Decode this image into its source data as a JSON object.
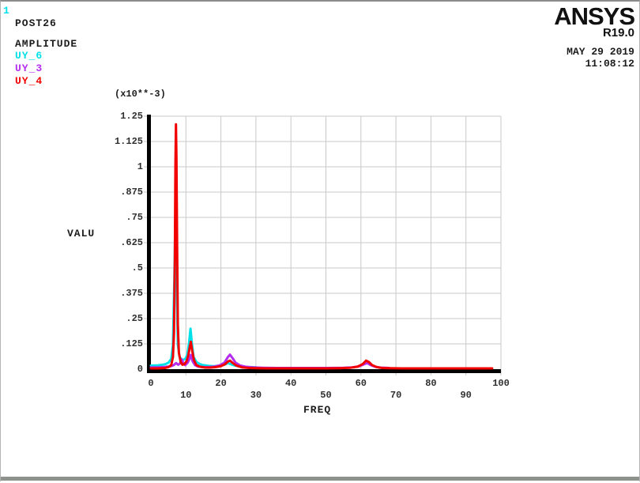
{
  "header": {
    "frame_number": "1",
    "routine": "POST26",
    "plot_type": "AMPLITUDE",
    "legend": [
      {
        "label": "UY_6",
        "color": "#00E0E8"
      },
      {
        "label": "UY_3",
        "color": "#B32CEF"
      },
      {
        "label": "UY_4",
        "color": "#F20000"
      }
    ]
  },
  "brand": {
    "name": "ANSYS",
    "release": "R19.0",
    "date": "MAY 29 2019",
    "time": "11:08:12"
  },
  "chart_data": {
    "type": "line",
    "title": "AMPLITUDE",
    "xlabel": "FREQ",
    "ylabel": "VALU",
    "y_scale_label": "(x10**-3)",
    "xlim": [
      0,
      100
    ],
    "ylim": [
      0,
      1.25
    ],
    "grid": true,
    "grid_color": "#c9c9c9",
    "axis_color": "#000000",
    "x_ticks": [
      {
        "value": 0,
        "label": "0"
      },
      {
        "value": 10,
        "label": "10"
      },
      {
        "value": 20,
        "label": "20"
      },
      {
        "value": 30,
        "label": "30"
      },
      {
        "value": 40,
        "label": "40"
      },
      {
        "value": 50,
        "label": "50"
      },
      {
        "value": 60,
        "label": "60"
      },
      {
        "value": 70,
        "label": "70"
      },
      {
        "value": 80,
        "label": "80"
      },
      {
        "value": 90,
        "label": "90"
      },
      {
        "value": 100,
        "label": "100"
      }
    ],
    "y_ticks": [
      {
        "value": 0,
        "label": "0"
      },
      {
        "value": 0.125,
        "label": ".125"
      },
      {
        "value": 0.25,
        "label": ".25"
      },
      {
        "value": 0.375,
        "label": ".375"
      },
      {
        "value": 0.5,
        "label": ".5"
      },
      {
        "value": 0.625,
        "label": ".625"
      },
      {
        "value": 0.75,
        "label": ".75"
      },
      {
        "value": 0.875,
        "label": ".875"
      },
      {
        "value": 1,
        "label": "1"
      },
      {
        "value": 1.125,
        "label": "1.125"
      },
      {
        "value": 1.25,
        "label": "1.25"
      }
    ],
    "series": [
      {
        "name": "UY_6",
        "color": "#00E0E8",
        "points": [
          [
            0,
            0.018
          ],
          [
            1,
            0.018
          ],
          [
            2,
            0.019
          ],
          [
            3,
            0.021
          ],
          [
            4,
            0.024
          ],
          [
            5,
            0.032
          ],
          [
            5.8,
            0.05
          ],
          [
            6.3,
            0.12
          ],
          [
            6.7,
            0.45
          ],
          [
            7.0,
            0.77
          ],
          [
            7.3,
            0.45
          ],
          [
            7.7,
            0.12
          ],
          [
            8.2,
            0.06
          ],
          [
            9,
            0.045
          ],
          [
            9.8,
            0.05
          ],
          [
            10.4,
            0.07
          ],
          [
            10.9,
            0.13
          ],
          [
            11.3,
            0.2
          ],
          [
            11.7,
            0.13
          ],
          [
            12.2,
            0.06
          ],
          [
            13,
            0.035
          ],
          [
            14,
            0.025
          ],
          [
            15,
            0.02
          ],
          [
            16.5,
            0.016
          ],
          [
            18,
            0.015
          ],
          [
            19.5,
            0.017
          ],
          [
            21,
            0.022
          ],
          [
            22,
            0.03
          ],
          [
            22.6,
            0.026
          ],
          [
            24,
            0.018
          ],
          [
            25.5,
            0.013
          ],
          [
            27,
            0.011
          ],
          [
            28.5,
            0.01
          ],
          [
            30,
            0.009
          ]
        ]
      },
      {
        "name": "UY_3",
        "color": "#B32CEF",
        "points": [
          [
            0,
            0.009
          ],
          [
            2,
            0.009
          ],
          [
            4,
            0.011
          ],
          [
            5.5,
            0.014
          ],
          [
            6.5,
            0.02
          ],
          [
            7.2,
            0.03
          ],
          [
            7.8,
            0.022
          ],
          [
            8.3,
            0.028
          ],
          [
            8.8,
            0.048
          ],
          [
            9.3,
            0.028
          ],
          [
            9.8,
            0.02
          ],
          [
            10.5,
            0.032
          ],
          [
            11,
            0.05
          ],
          [
            11.4,
            0.07
          ],
          [
            11.9,
            0.04
          ],
          [
            12.6,
            0.02
          ],
          [
            13.5,
            0.013
          ],
          [
            15,
            0.01
          ],
          [
            16.5,
            0.01
          ],
          [
            18,
            0.012
          ],
          [
            19.5,
            0.018
          ],
          [
            21,
            0.032
          ],
          [
            22,
            0.06
          ],
          [
            22.6,
            0.072
          ],
          [
            23.3,
            0.055
          ],
          [
            24.2,
            0.032
          ],
          [
            25.5,
            0.018
          ],
          [
            27,
            0.012
          ],
          [
            29,
            0.009
          ],
          [
            32,
            0.007
          ],
          [
            36,
            0.006
          ],
          [
            40,
            0.006
          ],
          [
            45,
            0.006
          ],
          [
            50,
            0.006
          ],
          [
            55,
            0.007
          ],
          [
            57.5,
            0.009
          ],
          [
            59.5,
            0.014
          ],
          [
            61,
            0.025
          ],
          [
            61.8,
            0.03
          ],
          [
            62.8,
            0.02
          ],
          [
            64,
            0.012
          ],
          [
            65.5,
            0.008
          ],
          [
            67,
            0.007
          ],
          [
            68,
            0.006
          ]
        ]
      },
      {
        "name": "UY_4",
        "color": "#F20000",
        "points": [
          [
            0,
            0.004
          ],
          [
            2,
            0.004
          ],
          [
            4,
            0.006
          ],
          [
            5,
            0.01
          ],
          [
            5.8,
            0.02
          ],
          [
            6.3,
            0.06
          ],
          [
            6.6,
            0.18
          ],
          [
            6.85,
            0.55
          ],
          [
            7.0,
            1.0
          ],
          [
            7.15,
            1.21
          ],
          [
            7.3,
            1.05
          ],
          [
            7.5,
            0.6
          ],
          [
            7.7,
            0.22
          ],
          [
            8,
            0.08
          ],
          [
            8.5,
            0.035
          ],
          [
            9,
            0.022
          ],
          [
            9.6,
            0.025
          ],
          [
            10.2,
            0.04
          ],
          [
            10.7,
            0.07
          ],
          [
            11.1,
            0.11
          ],
          [
            11.4,
            0.135
          ],
          [
            11.8,
            0.09
          ],
          [
            12.3,
            0.045
          ],
          [
            13,
            0.02
          ],
          [
            14,
            0.012
          ],
          [
            15.5,
            0.008
          ],
          [
            17,
            0.008
          ],
          [
            18.5,
            0.01
          ],
          [
            20,
            0.015
          ],
          [
            21.2,
            0.025
          ],
          [
            22,
            0.038
          ],
          [
            22.6,
            0.042
          ],
          [
            23.4,
            0.03
          ],
          [
            24.5,
            0.017
          ],
          [
            26,
            0.009
          ],
          [
            28,
            0.006
          ],
          [
            30,
            0.005
          ],
          [
            33,
            0.004
          ],
          [
            36,
            0.004
          ],
          [
            40,
            0.004
          ],
          [
            45,
            0.004
          ],
          [
            50,
            0.004
          ],
          [
            54,
            0.005
          ],
          [
            57,
            0.007
          ],
          [
            59,
            0.012
          ],
          [
            60.5,
            0.025
          ],
          [
            61.5,
            0.042
          ],
          [
            62.3,
            0.035
          ],
          [
            63.2,
            0.02
          ],
          [
            64.5,
            0.01
          ],
          [
            66,
            0.006
          ],
          [
            68,
            0.005
          ],
          [
            72,
            0.004
          ],
          [
            76,
            0.004
          ],
          [
            80,
            0.004
          ],
          [
            85,
            0.004
          ],
          [
            90,
            0.004
          ],
          [
            94,
            0.004
          ],
          [
            97.5,
            0.004
          ]
        ]
      }
    ]
  }
}
